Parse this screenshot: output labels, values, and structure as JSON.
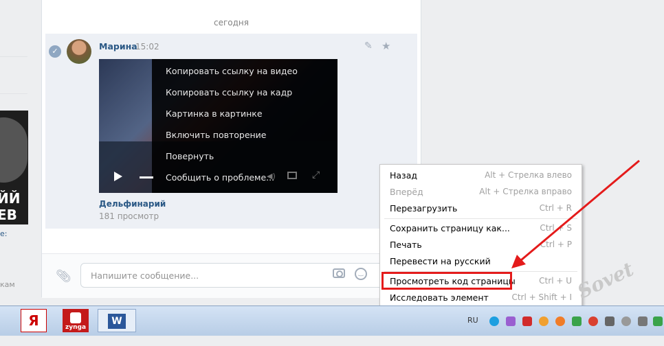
{
  "left": {
    "promo_line1": "ЙЙ",
    "promo_line2": "ЕВ",
    "link": "e:",
    "small": "кам"
  },
  "chat": {
    "date_separator": "сегодня",
    "message": {
      "author": "Марина",
      "time": "15:02",
      "video_title": "Дельфинарий",
      "video_views": "181 просмотр"
    },
    "video_menu": [
      "Копировать ссылку на видео",
      "Копировать ссылку на кадр",
      "Картинка в картинке",
      "Включить повторение",
      "Повернуть",
      "Сообщить о проблеме..."
    ],
    "composer": {
      "placeholder": "Напишите сообщение..."
    }
  },
  "context_menu": [
    {
      "label": "Назад",
      "shortcut": "Alt + Стрелка влево",
      "disabled": false
    },
    {
      "label": "Вперёд",
      "shortcut": "Alt + Стрелка вправо",
      "disabled": true
    },
    {
      "label": "Перезагрузить",
      "shortcut": "Ctrl + R",
      "disabled": false
    },
    {
      "label": "Сохранить страницу как...",
      "shortcut": "Ctrl + S",
      "disabled": false
    },
    {
      "label": "Печать",
      "shortcut": "Ctrl + P",
      "disabled": false
    },
    {
      "label": "Перевести на русский",
      "shortcut": "",
      "disabled": false
    },
    {
      "label": "Просмотреть код страницы",
      "shortcut": "Ctrl + U",
      "disabled": false
    },
    {
      "label": "Исследовать элемент",
      "shortcut": "Ctrl + Shift + I",
      "disabled": false
    }
  ],
  "highlight_color": "#e41b1b",
  "taskbar": {
    "yandex_label": "Я",
    "zynga_label": "zynga",
    "word_label": "W",
    "language": "RU",
    "tray_icons": [
      "skype-icon",
      "pen-icon",
      "shield-icon",
      "ok-icon",
      "flower-icon",
      "torrent-icon",
      "chrome-icon",
      "lock-icon",
      "clock-icon",
      "keyboard-icon",
      "chat-icon",
      "network-icon"
    ]
  },
  "watermark": "Sovet"
}
